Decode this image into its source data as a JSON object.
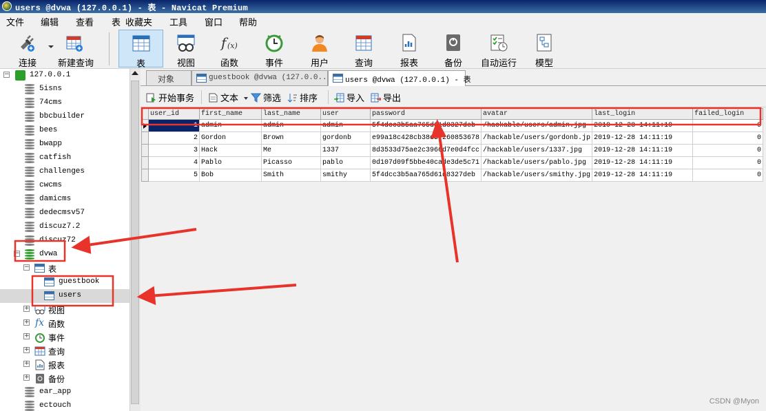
{
  "window": {
    "title": "users @dvwa (127.0.0.1) - 表 - Navicat Premium"
  },
  "menu": [
    "文件",
    "编辑",
    "查看",
    "表",
    "收藏夹",
    "工具",
    "窗口",
    "帮助"
  ],
  "toolbar": [
    {
      "label": "连接",
      "icon": "plug-icon"
    },
    {
      "label": "新建查询",
      "icon": "new-query-icon"
    },
    {
      "label": "表",
      "icon": "table-icon"
    },
    {
      "label": "视图",
      "icon": "view-icon"
    },
    {
      "label": "函数",
      "icon": "function-icon"
    },
    {
      "label": "事件",
      "icon": "clock-icon"
    },
    {
      "label": "用户",
      "icon": "user-icon"
    },
    {
      "label": "查询",
      "icon": "query-icon"
    },
    {
      "label": "报表",
      "icon": "report-icon"
    },
    {
      "label": "备份",
      "icon": "backup-icon"
    },
    {
      "label": "自动运行",
      "icon": "schedule-icon"
    },
    {
      "label": "模型",
      "icon": "model-icon"
    }
  ],
  "sidebar": {
    "connection": "127.0.0.1",
    "databases": [
      "5isns",
      "74cms",
      "bbcbuilder",
      "bees",
      "bwapp",
      "catfish",
      "challenges",
      "cwcms",
      "damicms",
      "dedecmsv57",
      "discuz7.2",
      "discuz72"
    ],
    "active_db": "dvwa",
    "tables_folder": "表",
    "tables": [
      "guestbook",
      "users"
    ],
    "folders": [
      "视图",
      "函数",
      "事件",
      "查询",
      "报表",
      "备份"
    ],
    "more_databases": [
      "ear_app",
      "ectouch"
    ]
  },
  "tabs": {
    "objects": "对象",
    "tab1": "guestbook @dvwa (127.0.0....",
    "tab2": "users @dvwa (127.0.0.1) - 表"
  },
  "subtoolbar": {
    "begin_transaction": "开始事务",
    "text": "文本",
    "filter": "筛选",
    "sort": "排序",
    "import": "导入",
    "export": "导出"
  },
  "table": {
    "columns": [
      "user_id",
      "first_name",
      "last_name",
      "user",
      "password",
      "avatar",
      "last_login",
      "failed_login"
    ],
    "rows": [
      [
        "1",
        "admin",
        "admin",
        "admin",
        "5f4dcc3b5aa765d61d8327deb",
        "/hackable/users/admin.jpg",
        "2019-12-28 14:11:19",
        "0"
      ],
      [
        "2",
        "Gordon",
        "Brown",
        "gordonb",
        "e99a18c428cb38d5f260853678",
        "/hackable/users/gordonb.jp",
        "2019-12-28 14:11:19",
        "0"
      ],
      [
        "3",
        "Hack",
        "Me",
        "1337",
        "8d3533d75ae2c3966d7e0d4fcc",
        "/hackable/users/1337.jpg",
        "2019-12-28 14:11:19",
        "0"
      ],
      [
        "4",
        "Pablo",
        "Picasso",
        "pablo",
        "0d107d09f5bbe40cade3de5c71",
        "/hackable/users/pablo.jpg",
        "2019-12-28 14:11:19",
        "0"
      ],
      [
        "5",
        "Bob",
        "Smith",
        "smithy",
        "5f4dcc3b5aa765d61d8327deb",
        "/hackable/users/smithy.jpg",
        "2019-12-28 14:11:19",
        "0"
      ]
    ]
  },
  "watermark": "CSDN @Myon⁠",
  "annotation_color": "#e8332a"
}
